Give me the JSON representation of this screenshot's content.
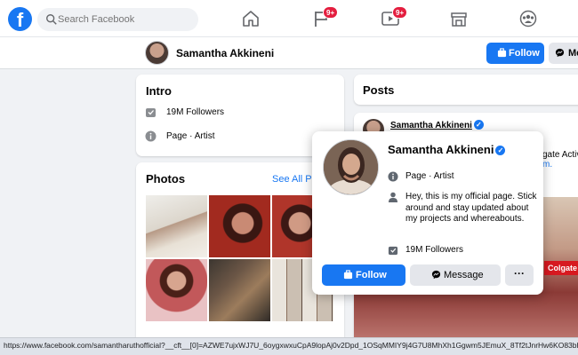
{
  "topbar": {
    "logo_letter": "f",
    "search_placeholder": "Search Facebook",
    "nav": [
      {
        "name": "home-icon"
      },
      {
        "name": "flag-icon",
        "badge": "9+"
      },
      {
        "name": "video-icon",
        "badge": "9+"
      },
      {
        "name": "marketplace-icon"
      },
      {
        "name": "groups-icon"
      }
    ],
    "badge_color": "#e41e3f"
  },
  "profile_strip": {
    "name": "Samantha Akkineni",
    "follow_label": "Follow",
    "message_label": "Me"
  },
  "intro": {
    "title": "Intro",
    "followers": "19M Followers",
    "category": "Page · Artist"
  },
  "photos": {
    "title": "Photos",
    "see_all": "See All Photos"
  },
  "posts": {
    "title": "Posts",
    "author": "Samantha Akkineni",
    "peek_text_1": "gate Activ",
    "peek_text_2": "m.",
    "ad_text": "Colgate"
  },
  "hover_card": {
    "name": "Samantha Akkineni",
    "category": "Page · Artist",
    "bio": "Hey, this is my official page. Stick around and stay updated about my projects and whereabouts.",
    "followers": "19M Followers",
    "follow_label": "Follow",
    "message_label": "Message",
    "more_label": "···"
  },
  "statusbar": {
    "url": "https://www.facebook.com/samantharuthofficial?__cft__[0]=AZWE7ujxWJ7U_6oygxwxuCpA9lopAj0v2Dpd_1OSqMMIY9j4G7U8MhXh1Ggwm5JEmuX_8Tf2tJnrHw6KO83bhKgxH4bhbKndtTPV"
  },
  "colors": {
    "brand": "#1877f2",
    "background": "#f0f2f5"
  }
}
